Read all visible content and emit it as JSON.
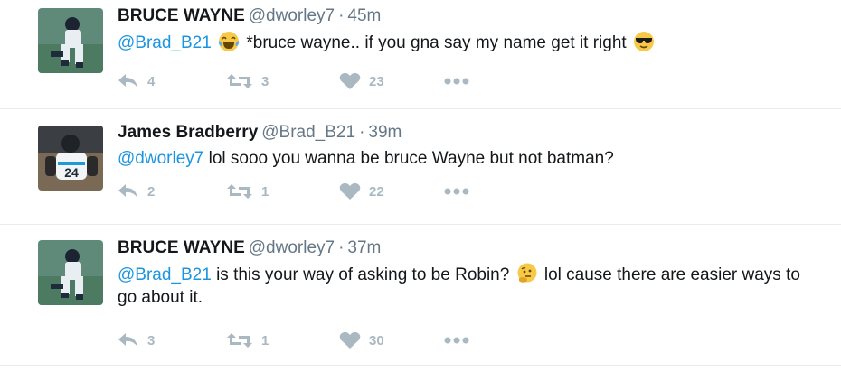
{
  "tweets": [
    {
      "name": "BRUCE WAYNE",
      "handle": "@dworley7",
      "time": "45m",
      "text": [
        {
          "type": "mention",
          "value": "@Brad_B21"
        },
        {
          "type": "emoji",
          "icon": "tears-of-joy-emoji"
        },
        {
          "type": "text",
          "value": "*bruce wayne.. if you gna say my name get it right"
        },
        {
          "type": "emoji",
          "icon": "sunglasses-emoji"
        }
      ],
      "replies": "4",
      "retweets": "3",
      "likes": "23"
    },
    {
      "name": "James Bradberry",
      "handle": "@Brad_B21",
      "time": "39m",
      "text": [
        {
          "type": "mention",
          "value": "@dworley7"
        },
        {
          "type": "text",
          "value": "lol sooo you wanna be bruce Wayne but not batman?"
        }
      ],
      "replies": "2",
      "retweets": "1",
      "likes": "22"
    },
    {
      "name": "BRUCE WAYNE",
      "handle": "@dworley7",
      "time": "37m",
      "text": [
        {
          "type": "mention",
          "value": "@Brad_B21"
        },
        {
          "type": "text",
          "value": "is this your way of asking to be Robin?"
        },
        {
          "type": "emoji",
          "icon": "thinking-face-emoji"
        },
        {
          "type": "text",
          "value": "lol cause there are easier ways to go about it."
        }
      ],
      "replies": "3",
      "retweets": "1",
      "likes": "30"
    }
  ],
  "separator": "·",
  "colors": {
    "mention": "#1b95e0",
    "meta": "#657786",
    "action": "#aab8c2",
    "divider": "#e6ecf0"
  }
}
